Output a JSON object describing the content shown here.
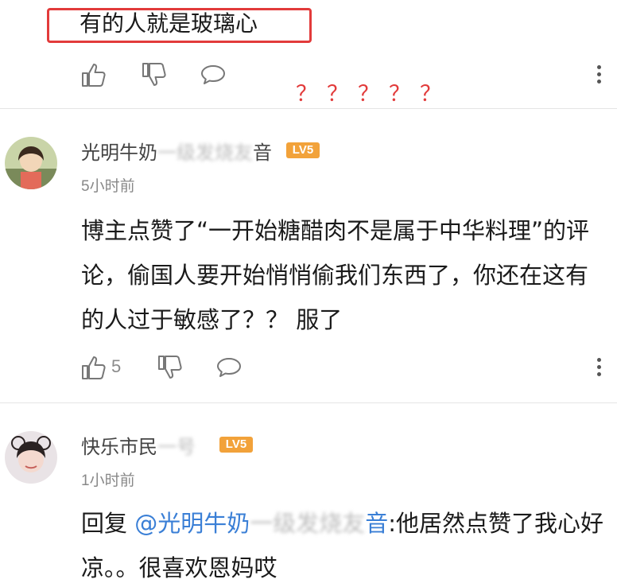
{
  "top_comment": {
    "text": "有的人就是玻璃心",
    "question_marks": "？？？？？"
  },
  "comments": [
    {
      "username_visible": "光明牛奶",
      "username_blurred": "一级发烧友",
      "username_tail": "音",
      "level": "LV5",
      "time": "5小时前",
      "body": "博主点赞了“一开始糖醋肉不是属于中华料理”的评论，偷国人要开始悄悄偷我们东西了，你还在这有的人过于敏感了？？ 服了",
      "likes": "5"
    },
    {
      "username_visible": "快乐市民",
      "username_blurred": "一号",
      "level": "LV5",
      "time": "1小时前",
      "reply_prefix": "回复",
      "mention_visible": "@光明牛奶",
      "mention_blurred": "一级发烧友",
      "mention_tail": "音",
      "reply_text": ":他居然点赞了我心好凉。。很喜欢恩妈哎"
    }
  ],
  "icons": [
    "thumbs-up-icon",
    "thumbs-down-icon",
    "comment-bubble-icon",
    "more-vertical-icon"
  ],
  "colors": {
    "highlight_red": "#e23b3b",
    "mention_blue": "#3a7fd6",
    "level_badge": "#f2a23a"
  }
}
